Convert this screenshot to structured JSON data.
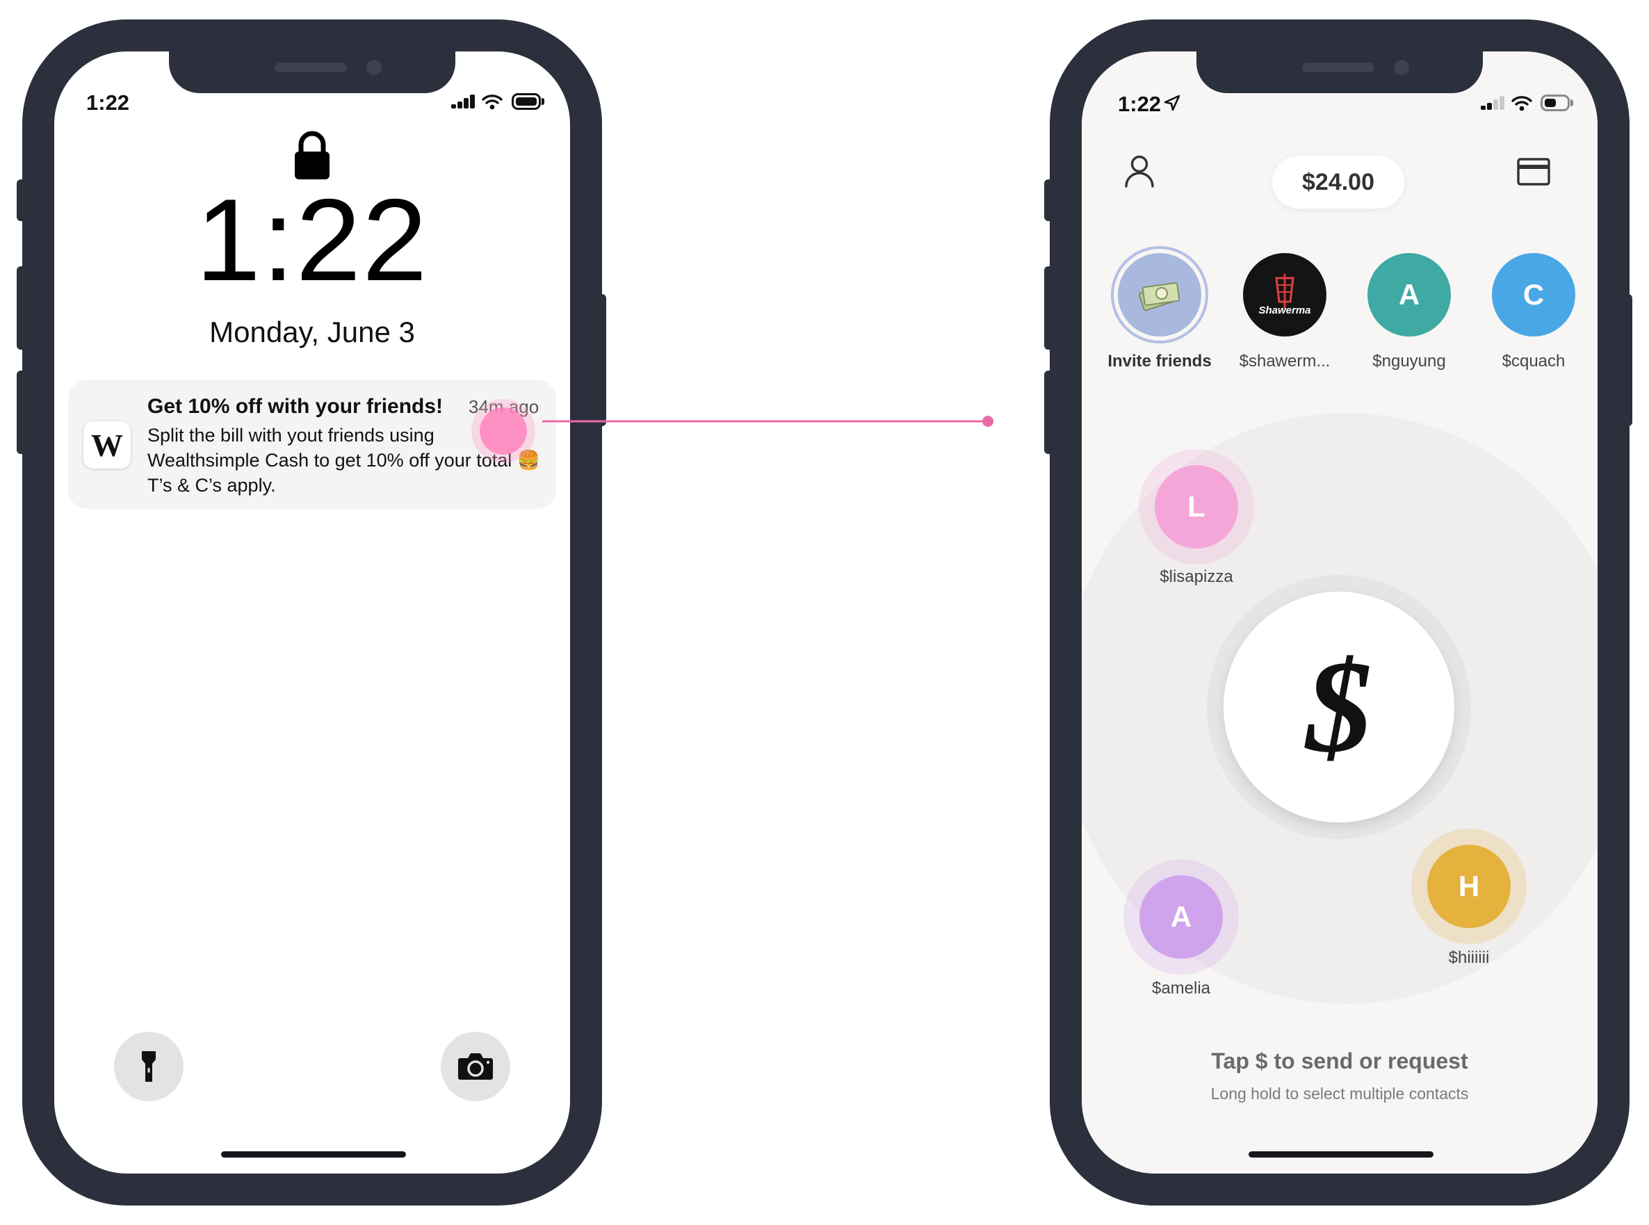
{
  "left_phone": {
    "status_time": "1:22",
    "lock_time": "1:22",
    "date": "Monday, June 3",
    "notification": {
      "app_logo": "W",
      "title": "Get 10% off with your friends!",
      "time_ago": "34m ago",
      "body_lines": [
        "Split the bill with yout friends using",
        "Wealthsimple Cash to get 10% off your total 🍔",
        "T’s & C’s apply."
      ]
    },
    "icons": [
      "lock-icon",
      "flashlight-icon",
      "camera-icon",
      "signal-icon",
      "wifi-icon",
      "battery-icon"
    ]
  },
  "right_phone": {
    "status_time": "1:22",
    "balance": "$24.00",
    "top_contacts": [
      {
        "label": "Invite friends",
        "initial": "",
        "color": "#a9b8de"
      },
      {
        "label": "$shawerm...",
        "initial": "",
        "color": "#141414"
      },
      {
        "label": "$nguyung",
        "initial": "A",
        "color": "#3fa9a3"
      },
      {
        "label": "$cquach",
        "initial": "C",
        "color": "#4aa7e6"
      }
    ],
    "shawerma_logo_text": "Shawerma",
    "bubble_contacts": [
      {
        "label": "$lisapizza",
        "initial": "L",
        "color": "#f5a6d8"
      },
      {
        "label": "$amelia",
        "initial": "A",
        "color": "#d0a4ec"
      },
      {
        "label": "$hiiiiii",
        "initial": "H",
        "color": "#e6b23e"
      }
    ],
    "center_symbol": "$",
    "hint_title": "Tap $ to send or request",
    "hint_sub": "Long hold to select multiple contacts",
    "icons": [
      "location-arrow-icon",
      "profile-icon",
      "card-icon",
      "signal-icon",
      "wifi-icon",
      "battery-icon"
    ]
  },
  "colors": {
    "phone_frame": "#2c2f3c",
    "tap_indicator": "#ff8ec3",
    "connector_line": "#ea6aa8"
  }
}
